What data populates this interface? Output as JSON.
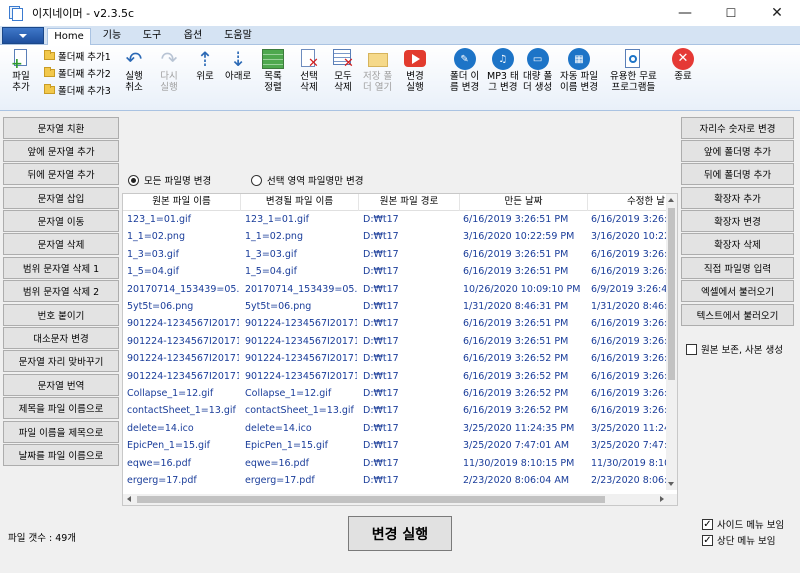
{
  "window": {
    "title": "이지네이머 - v2.3.5c",
    "controls": {
      "minimize": "—",
      "maximize": "☐",
      "close": "✕"
    }
  },
  "tabs": [
    {
      "label": "Home",
      "active": true
    },
    {
      "label": "기능",
      "active": false
    },
    {
      "label": "도구",
      "active": false
    },
    {
      "label": "옵션",
      "active": false
    },
    {
      "label": "도움말",
      "active": false
    }
  ],
  "ribbon": {
    "add_file": "파일\n추가",
    "add_folder1": "폴더째 추가1",
    "add_folder2": "폴더째 추가2",
    "add_folder3": "폴더째 추가3",
    "undo": "실행\n취소",
    "redo": "다시\n실행",
    "up": "위로",
    "down": "아래로",
    "sort_list": "목록\n정렬",
    "delete_selected": "선택\n삭제",
    "delete_all": "모두\n삭제",
    "open_save_folder": "저장 폴\n더 열기",
    "run_change": "변경\n실행",
    "rename_folder": "폴더 이\n름 변경",
    "mp3_tag": "MP3 태\n그 변경",
    "bulk_folder": "대량 폴\n더 생성",
    "auto_filename": "자동 파일\n이름 변경",
    "free_programs": "유용한 무료\n프로그램들",
    "exit": "종료"
  },
  "left_buttons": [
    "문자열 치환",
    "앞에 문자열 추가",
    "뒤에 문자열 추가",
    "문자열 삽입",
    "문자열 이동",
    "문자열 삭제",
    "범위 문자열 삭제 1",
    "범위 문자열 삭제 2",
    "번호 붙이기",
    "대소문자 변경",
    "문자열 자리 맞바꾸기",
    "문자열 번역",
    "제목을 파일 이름으로",
    "파일 이름을 제목으로",
    "날짜를 파일 이름으로"
  ],
  "right_buttons": [
    "자리수 숫자로 변경",
    "앞에 폴더명 추가",
    "뒤에 폴더명 추가",
    "확장자 추가",
    "확장자 변경",
    "확장자 삭제",
    "직접 파일명 입력",
    "엑셀에서 불러오기",
    "텍스트에서 불러오기"
  ],
  "options": {
    "keep_original": "원본 보존, 사본 생성",
    "show_side_menu": "사이드 메뉴 보임",
    "show_top_menu": "상단 메뉴 보임"
  },
  "radio": {
    "all_files": "모든 파일명 변경",
    "selected_only": "선택 영역 파일명만 변경"
  },
  "table": {
    "columns": [
      "원본 파일 이름",
      "변경될 파일 이름",
      "원본 파일 경로",
      "만든 날짜",
      "수정한 날"
    ],
    "rows": [
      [
        "123_1=01.gif",
        "123_1=01.gif",
        "D:₩t17",
        "6/16/2019 3:26:51 PM",
        "6/16/2019 3:26:51"
      ],
      [
        "1_1=02.png",
        "1_1=02.png",
        "D:₩t17",
        "3/16/2020 10:22:59 PM",
        "3/16/2020 10:22:5"
      ],
      [
        "1_3=03.gif",
        "1_3=03.gif",
        "D:₩t17",
        "6/16/2019 3:26:51 PM",
        "6/16/2019 3:26:51"
      ],
      [
        "1_5=04.gif",
        "1_5=04.gif",
        "D:₩t17",
        "6/16/2019 3:26:51 PM",
        "6/16/2019 3:26:51"
      ],
      [
        "20170714_153439=05.jpg",
        "20170714_153439=05.jpg",
        "D:₩t17",
        "10/26/2020 10:09:10 PM",
        "6/9/2019 3:26:47"
      ],
      [
        "5yt5t=06.png",
        "5yt5t=06.png",
        "D:₩t17",
        "1/31/2020 8:46:31 PM",
        "1/31/2020 8:46:3"
      ],
      [
        "901224-1234567I2017101",
        "901224-1234567I2017101",
        "D:₩t17",
        "6/16/2019 3:26:51 PM",
        "6/16/2019 3:26:51"
      ],
      [
        "901224-1234567I2017101",
        "901224-1234567I2017101",
        "D:₩t17",
        "6/16/2019 3:26:51 PM",
        "6/16/2019 3:26:52"
      ],
      [
        "901224-1234567I2017101",
        "901224-1234567I2017101",
        "D:₩t17",
        "6/16/2019 3:26:52 PM",
        "6/16/2019 3:26:52"
      ],
      [
        "901224-1234567I2017101",
        "901224-1234567I2017101",
        "D:₩t17",
        "6/16/2019 3:26:52 PM",
        "6/16/2019 3:26:52"
      ],
      [
        "Collapse_1=12.gif",
        "Collapse_1=12.gif",
        "D:₩t17",
        "6/16/2019 3:26:52 PM",
        "6/16/2019 3:26:52"
      ],
      [
        "contactSheet_1=13.gif",
        "contactSheet_1=13.gif",
        "D:₩t17",
        "6/16/2019 3:26:52 PM",
        "6/16/2019 3:26:52"
      ],
      [
        "delete=14.ico",
        "delete=14.ico",
        "D:₩t17",
        "3/25/2020 11:24:35 PM",
        "3/25/2020 11:24:3"
      ],
      [
        "EpicPen_1=15.gif",
        "EpicPen_1=15.gif",
        "D:₩t17",
        "3/25/2020 7:47:01 AM",
        "3/25/2020 7:47:01"
      ],
      [
        "eqwe=16.pdf",
        "eqwe=16.pdf",
        "D:₩t17",
        "11/30/2019 8:10:15 PM",
        "11/30/2019 8:10:1"
      ],
      [
        "ergerg=17.pdf",
        "ergerg=17.pdf",
        "D:₩t17",
        "2/23/2020 8:06:04 AM",
        "2/23/2020 8:06:04"
      ]
    ]
  },
  "run_button": "변경 실행",
  "status": {
    "file_count": "파일 갯수 : 49개"
  }
}
